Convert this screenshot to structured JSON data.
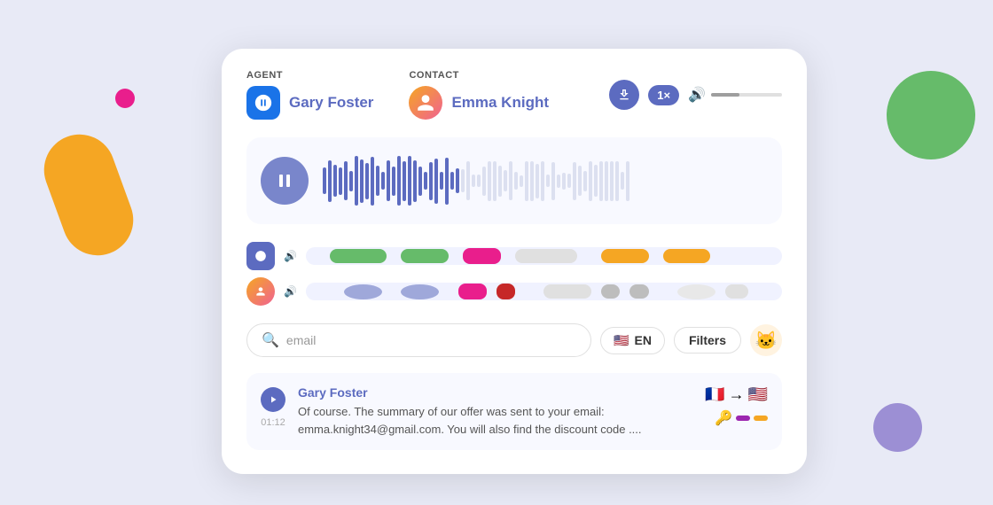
{
  "background": {
    "color": "#e8eaf6"
  },
  "card": {
    "agent_label": "AGENT",
    "contact_label": "CONTACT",
    "agent_name": "Gary Foster",
    "contact_name": "Emma Knight",
    "speed_label": "1×",
    "volume_pct": 40,
    "waveform_bars": 60,
    "waveform_active_count": 28
  },
  "search": {
    "placeholder": "email",
    "lang_label": "EN",
    "filter_label": "Filters"
  },
  "message": {
    "sender": "Gary Foster",
    "timestamp": "01:12",
    "text": "Of course. The summary of our offer was sent to your email: emma.knight34@gmail.com. You will also find the discount code ....",
    "from_flag": "🇫🇷",
    "to_flag": "🇺🇸"
  }
}
